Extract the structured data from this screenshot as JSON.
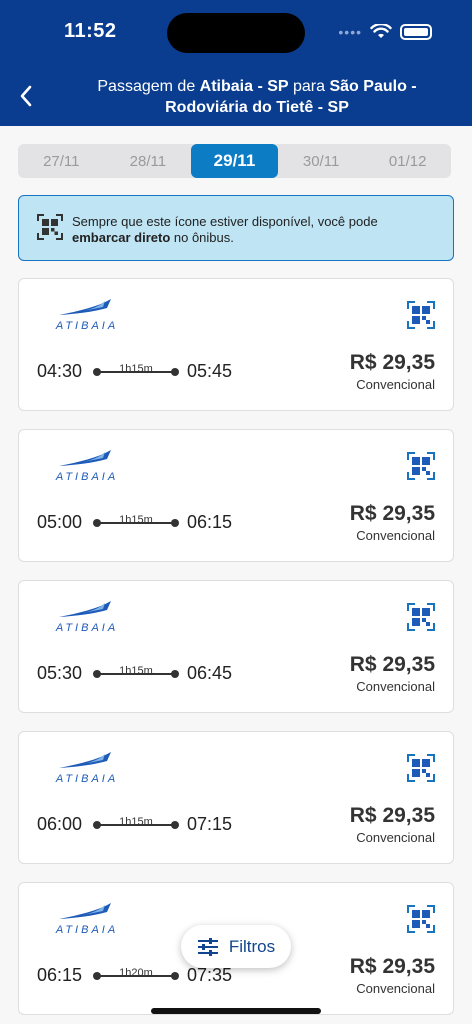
{
  "status_bar": {
    "time": "11:52",
    "dots": "••••"
  },
  "header": {
    "title_prefix": "Passagem de ",
    "origin": "Atibaia - SP",
    "connector": " para ",
    "destination": "São Paulo - Rodoviária do Tietê - SP"
  },
  "dates": [
    {
      "label": "27/11",
      "active": false
    },
    {
      "label": "28/11",
      "active": false
    },
    {
      "label": "29/11",
      "active": true
    },
    {
      "label": "30/11",
      "active": false
    },
    {
      "label": "01/12",
      "active": false
    }
  ],
  "info_banner": {
    "text_before": "Sempre que este ícone estiver disponível, você pode ",
    "bold": "embarcar direto",
    "text_after": "  no ônibus."
  },
  "trips": [
    {
      "company": "ATIBAIA",
      "departure": "04:30",
      "duration": "1h15m",
      "arrival": "05:45",
      "price": "R$ 29,35",
      "class": "Convencional"
    },
    {
      "company": "ATIBAIA",
      "departure": "05:00",
      "duration": "1h15m",
      "arrival": "06:15",
      "price": "R$ 29,35",
      "class": "Convencional"
    },
    {
      "company": "ATIBAIA",
      "departure": "05:30",
      "duration": "1h15m",
      "arrival": "06:45",
      "price": "R$ 29,35",
      "class": "Convencional"
    },
    {
      "company": "ATIBAIA",
      "departure": "06:00",
      "duration": "1h15m",
      "arrival": "07:15",
      "price": "R$ 29,35",
      "class": "Convencional"
    },
    {
      "company": "ATIBAIA",
      "departure": "06:15",
      "duration": "1h20m",
      "arrival": "07:35",
      "price": "R$ 29,35",
      "class": "Convencional"
    }
  ],
  "filters_button": {
    "label": "Filtros"
  },
  "colors": {
    "header": "#0a3d8f",
    "accent": "#0c7cc4",
    "banner": "#bfe4f4",
    "logo": "#1e5bb8"
  }
}
